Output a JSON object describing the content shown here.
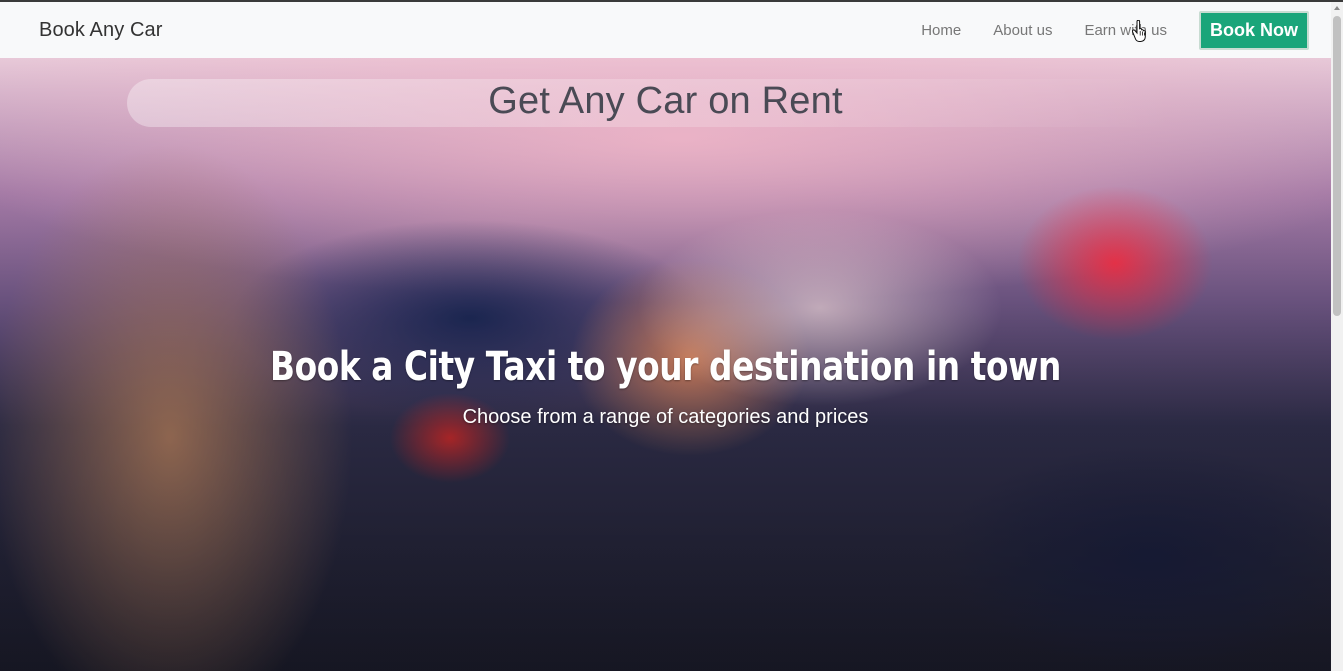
{
  "navbar": {
    "brand": "Book Any Car",
    "links": [
      "Home",
      "About us",
      "Earn with us"
    ],
    "cta_label": "Book Now",
    "cta_color": "#1aa57a"
  },
  "hero": {
    "title": "Get Any Car on Rent",
    "headline": "Book a City Taxi to your destination in town",
    "subheadline": "Choose from a range of categories and prices",
    "background_description_icon": "car-interior-photo"
  },
  "cursor": {
    "icon": "hand-pointer-icon"
  }
}
